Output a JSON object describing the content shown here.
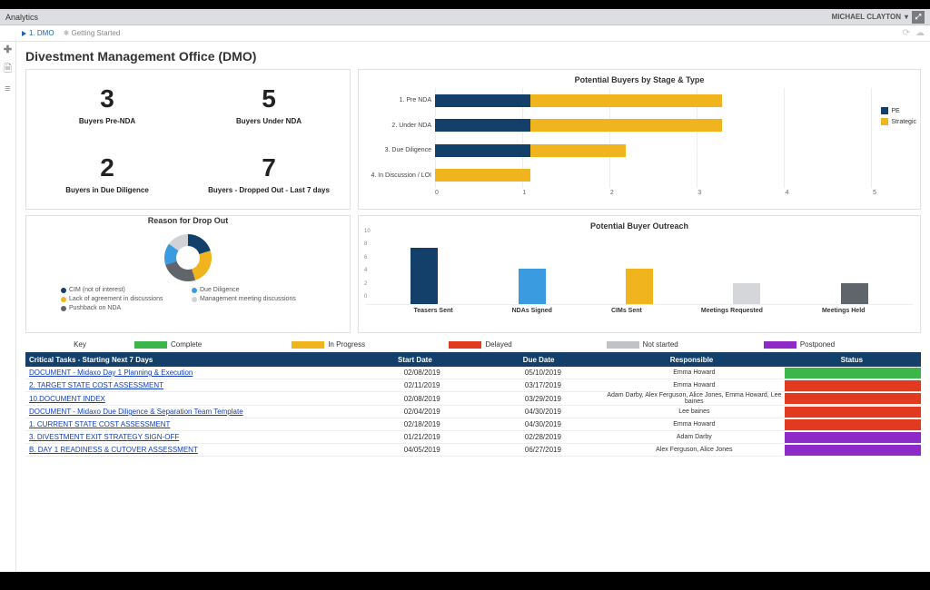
{
  "topbar": {
    "title": "Analytics",
    "user": "MICHAEL CLAYTON"
  },
  "tabs": {
    "active": "1. DMO",
    "second": "Getting Started"
  },
  "page_title": "Divestment Management Office (DMO)",
  "kpis": [
    {
      "value": "3",
      "label": "Buyers Pre-NDA"
    },
    {
      "value": "5",
      "label": "Buyers Under NDA"
    },
    {
      "value": "2",
      "label": "Buyers in Due Diligence"
    },
    {
      "value": "7",
      "label": "Buyers - Dropped Out - Last 7 days"
    }
  ],
  "stage_chart": {
    "title": "Potential Buyers by Stage & Type",
    "legend": {
      "pe": "PE",
      "strategic": "Strategic"
    },
    "categories": [
      "1. Pre NDA",
      "2. Under NDA",
      "3. Due Diligence",
      "4. In Discussion / LOI"
    ],
    "x_ticks": [
      "0",
      "1",
      "2",
      "3",
      "4",
      "5"
    ]
  },
  "dropout": {
    "title": "Reason for Drop Out",
    "legend": [
      {
        "color": "#12406b",
        "label": "CIM (not of interest)"
      },
      {
        "color": "#3a9be0",
        "label": "Due Diligence"
      },
      {
        "color": "#f0b51e",
        "label": "Lack of agreement in discussions"
      },
      {
        "color": "#d0d2d5",
        "label": "Management meeting discussions"
      },
      {
        "color": "#60656c",
        "label": "Pushback on NDA"
      }
    ]
  },
  "outreach": {
    "title": "Potential Buyer Outreach",
    "y_ticks": [
      "10",
      "8",
      "6",
      "4",
      "2",
      "0"
    ],
    "bars": [
      {
        "label": "Teasers Sent",
        "value": 8,
        "color": "#12406b"
      },
      {
        "label": "NDAs Signed",
        "value": 5,
        "color": "#3a9be0"
      },
      {
        "label": "CIMs Sent",
        "value": 5,
        "color": "#f0b51e"
      },
      {
        "label": "Meetings Requested",
        "value": 3,
        "color": "#d4d6d9"
      },
      {
        "label": "Meetings Held",
        "value": 3,
        "color": "#60656c"
      }
    ]
  },
  "key": {
    "label": "Key",
    "items": [
      {
        "color": "#3cb54b",
        "label": "Complete"
      },
      {
        "color": "#f0b51e",
        "label": "In Progress"
      },
      {
        "color": "#e23a1f",
        "label": "Delayed"
      },
      {
        "color": "#c0c2c5",
        "label": "Not started"
      },
      {
        "color": "#8e2ac7",
        "label": "Postponed"
      }
    ]
  },
  "table": {
    "headers": {
      "tasks": "Critical Tasks - Starting Next 7 Days",
      "start": "Start Date",
      "due": "Due Date",
      "resp": "Responsible",
      "status": "Status"
    },
    "rows": [
      {
        "task": "DOCUMENT - Midaxo Day 1 Planning & Execution",
        "start": "02/08/2019",
        "due": "05/10/2019",
        "resp": "Emma Howard",
        "status": "#3cb54b"
      },
      {
        "task": "2. TARGET STATE COST ASSESSMENT",
        "start": "02/11/2019",
        "due": "03/17/2019",
        "resp": "Emma Howard",
        "status": "#e23a1f"
      },
      {
        "task": "10.DOCUMENT INDEX",
        "start": "02/08/2019",
        "due": "03/29/2019",
        "resp": "Adam Darby, Alex Ferguson, Alice Jones, Emma Howard, Lee baines",
        "status": "#e23a1f"
      },
      {
        "task": "DOCUMENT - Midaxo Due Diligence & Separation Team Template",
        "start": "02/04/2019",
        "due": "04/30/2019",
        "resp": "Lee baines",
        "status": "#e23a1f"
      },
      {
        "task": "1. CURRENT STATE COST ASSESSMENT",
        "start": "02/18/2019",
        "due": "04/30/2019",
        "resp": "Emma Howard",
        "status": "#e23a1f"
      },
      {
        "task": "3. DIVESTMENT EXIT STRATEGY SIGN-OFF",
        "start": "01/21/2019",
        "due": "02/28/2019",
        "resp": "Adam Darby",
        "status": "#8e2ac7"
      },
      {
        "task": "B. DAY 1 READINESS & CUTOVER ASSESSMENT",
        "start": "04/05/2019",
        "due": "06/27/2019",
        "resp": "Alex Ferguson, Alice Jones",
        "status": "#8e2ac7"
      }
    ]
  },
  "chart_data": [
    {
      "type": "bar",
      "orientation": "horizontal-stacked",
      "title": "Potential Buyers by Stage & Type",
      "categories": [
        "1. Pre NDA",
        "2. Under NDA",
        "3. Due Diligence",
        "4. In Discussion / LOI"
      ],
      "series": [
        {
          "name": "PE",
          "values": [
            1,
            1,
            1,
            0
          ],
          "color": "#12406b"
        },
        {
          "name": "Strategic",
          "values": [
            2,
            2,
            1,
            1
          ],
          "color": "#f0b51e"
        }
      ],
      "xlim": [
        0,
        5
      ]
    },
    {
      "type": "pie",
      "title": "Reason for Drop Out",
      "slices": [
        {
          "label": "CIM (not of interest)",
          "value": 20,
          "color": "#12406b"
        },
        {
          "label": "Lack of agreement in discussions",
          "value": 25,
          "color": "#f0b51e"
        },
        {
          "label": "Pushback on NDA",
          "value": 25,
          "color": "#60656c"
        },
        {
          "label": "Due Diligence",
          "value": 15,
          "color": "#3a9be0"
        },
        {
          "label": "Management meeting discussions",
          "value": 15,
          "color": "#d0d2d5"
        }
      ]
    },
    {
      "type": "bar",
      "title": "Potential Buyer Outreach",
      "categories": [
        "Teasers Sent",
        "NDAs Signed",
        "CIMs Sent",
        "Meetings Requested",
        "Meetings Held"
      ],
      "values": [
        8,
        5,
        5,
        3,
        3
      ],
      "colors": [
        "#12406b",
        "#3a9be0",
        "#f0b51e",
        "#d4d6d9",
        "#60656c"
      ],
      "ylim": [
        0,
        10
      ]
    }
  ]
}
